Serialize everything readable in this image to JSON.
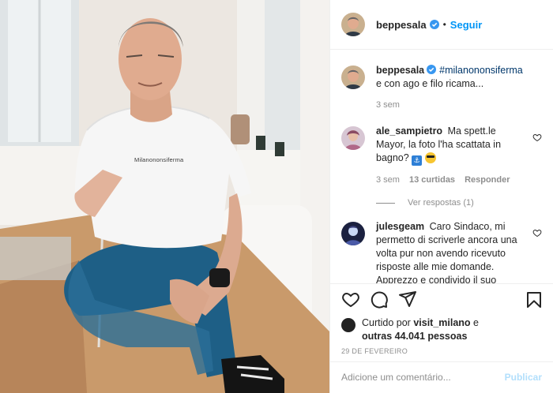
{
  "header": {
    "username": "beppesala",
    "separator": "•",
    "follow_label": "Seguir"
  },
  "caption": {
    "username": "beppesala",
    "hashtag": "#milanononsiferma",
    "text": " e con ago e filo ricama...",
    "time": "3 sem"
  },
  "comments": [
    {
      "username": "ale_sampietro",
      "text": "Ma spett.le Mayor, la foto l'ha scattata in bagno?",
      "time": "3 sem",
      "likes": "13 curtidas",
      "reply_label": "Responder",
      "view_replies": "Ver respostas (1)"
    },
    {
      "username": "julesgeam",
      "text": "Caro Sindaco, mi permetto di scriverle ancora una volta pur non avendo ricevuto risposte alle mie domande. Apprezzo e condivido il suo appello al mantenere forte il senso civico"
    }
  ],
  "likes": {
    "prefix": "Curtido por ",
    "by_user": "visit_milano",
    "middle": " e",
    "others": "outras 44.041 pessoas"
  },
  "date": "29 DE FEVEREIRO",
  "add_comment": {
    "placeholder": "Adicione um comentário...",
    "publish_label": "Publicar"
  },
  "photo": {
    "shirt_text": "Milanononsiferma"
  },
  "colors": {
    "accent": "#0095f6",
    "text": "#262626",
    "muted": "#8e8e8e",
    "border": "#efefef"
  },
  "icons": [
    "verified-badge-icon",
    "heart-icon",
    "comment-icon",
    "share-icon",
    "bookmark-icon"
  ]
}
